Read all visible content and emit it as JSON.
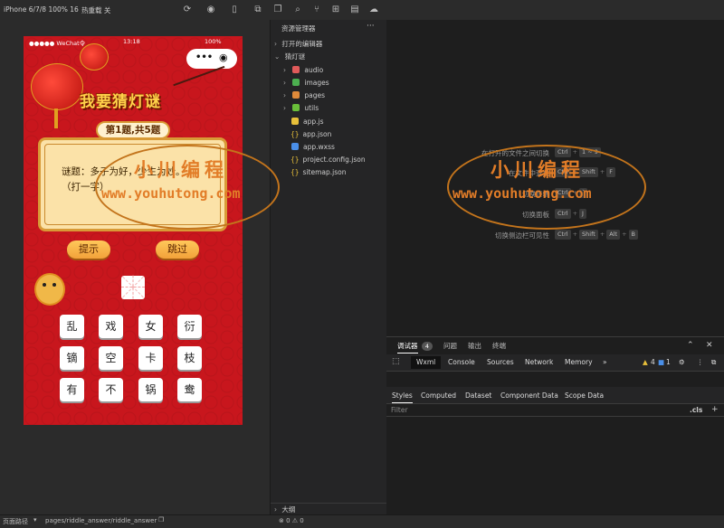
{
  "toolbar": {
    "device": "iPhone 6/7/8 100% 16",
    "hot_reload": "热重载 关"
  },
  "phone": {
    "carrier": "●●●●● WeChat令",
    "time": "13:18",
    "battery": "100%",
    "game_title": "我要猜灯谜",
    "question_progress": "第1题,共5题",
    "riddle_line1": "谜题：多子为好，少生为妙。",
    "riddle_line2": "（打一字）",
    "hint_button": "提示",
    "skip_button": "跳过",
    "char_grid": [
      [
        "乱",
        "戏",
        "女",
        "衍"
      ],
      [
        "镝",
        "空",
        "卡",
        "枝"
      ],
      [
        "有",
        "不",
        "锅",
        "鸯"
      ]
    ]
  },
  "explorer": {
    "title": "资源管理器",
    "more": "···",
    "open_editors": "打开的编辑器",
    "project": "猜灯谜",
    "folders": [
      "audio",
      "images",
      "pages",
      "utils"
    ],
    "files": [
      "app.js",
      "app.json",
      "app.wxss",
      "project.config.json",
      "sitemap.json"
    ],
    "outline": "大纲",
    "colors": {
      "audio": "#e05a5a",
      "images": "#4caf50",
      "pages": "#e08a3a",
      "utils": "#6abf3a",
      "js": "#e8c03a",
      "json": "#e8c03a",
      "wxss": "#4a8fe8"
    }
  },
  "shortcuts": [
    {
      "label": "在打开的文件之间切换",
      "keys": [
        "Ctrl",
        "1 ~ 9"
      ]
    },
    {
      "label": "在文件中查找",
      "keys": [
        "Ctrl",
        "Shift",
        "F"
      ]
    },
    {
      "label": "切换终端",
      "keys": [
        "Ctrl",
        "`"
      ]
    },
    {
      "label": "切换面板",
      "keys": [
        "Ctrl",
        "J"
      ]
    },
    {
      "label": "切换侧边栏可见性",
      "keys": [
        "Ctrl",
        "Shift",
        "Alt",
        "B"
      ]
    }
  ],
  "debugger": {
    "tabs": [
      "调试器",
      "问题",
      "输出",
      "终端"
    ],
    "badge": "4",
    "panels": [
      "Wxml",
      "Console",
      "Sources",
      "Network",
      "Memory"
    ],
    "more": "»",
    "warnings": "4",
    "messages": "1",
    "style_tabs": [
      "Styles",
      "Computed",
      "Dataset",
      "Component Data",
      "Scope Data"
    ],
    "filter": "Filter",
    "cls": ".cls"
  },
  "status": {
    "path_label": "页面路径",
    "path": "pages/riddle_answer/riddle_answer",
    "counts": "⊗ 0 ⚠ 0"
  },
  "watermark": {
    "title": "小川编程",
    "url": "www.youhutong.com"
  }
}
